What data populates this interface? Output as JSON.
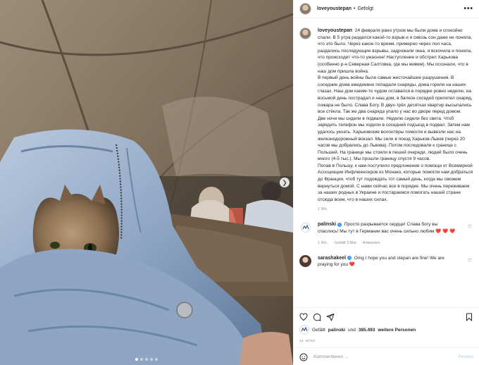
{
  "post": {
    "username": "loveyoustepan",
    "separator": "•",
    "follow_status": "Gefolgt",
    "more_label": "•••",
    "caption": "24 февраля рано утром мы были дома и спокойно спали. В 5 утра раздался какой-то взрыв и я сквозь сон даже не поняла, что это было. Через какое-то время, примерно через пол часа, раздались последующие взрывы, задрожали окна, я вскочила и поняла, что происходит что-то ужасное! Наступление и обстрел Харькова (особенно р-н Северная Салтовка, где мы живем). Мы осознали, что в наш дом пришла война.\nВ первый день войны были самые жесточайшие разрушения. В соседние дома ежедневно попадали снаряды, дома горели на наших глазах. Наш дом каким-то чудом оставался в порядке ровно неделю, на восьмой день пострадал и наш дом, в балкон соседей прилетел снаряд, пожара не было, Слава Богу. В двух-трёх десятках квартир высыпались все стёкла. Так же два снаряда упало у нас во дворе перед домом.\nДве ночи мы сидели в подвале. Неделю сидели без света. Чтоб зарядить телефон мы ходили в соседний подъезд в подвал. Затем нам удалось уехать. Харьковские волонтёры помогли и вывезли нас на железнодорожный вокзал. Мы сели в поезд Харьков-Львов (через 20 часов мы добрались до Львова). Потом последовали к границе с Польшей. На границе мы стояли в пешей очереди, людей было очень много (4-5 тыс.). Мы прошли границу спустя 9 часов.\nПопав в Польшу, к нам поступило предложение о помощи от Всемирной Ассоциации Инфлюенсеров из Монако, которые помогли нам добраться до Франции, чтоб тут подождать тот самый день, когда мы сможем вернуться домой. С нами сейчас все в порядке. Мы очень переживаем за наших родных в Украине и постараемся помогать нашей стране отсюда всем, что в наших силах.",
    "caption_age": "1 Wo."
  },
  "comments": [
    {
      "username": "palinski",
      "verified_mark": "✓",
      "text": "Просто разрывается сердце! Слава богу вы спаслись! Мы тут в Германии вас очень сильно любим",
      "hearts": "❤️ ❤️ ❤️",
      "age": "1 Wo.",
      "likes": "Gefällt 3 Mal",
      "reply": "Antworten"
    },
    {
      "username": "sarashakeel",
      "verified_mark": "✓",
      "text": "Omg I hope you and stepan are fine! We are praying for you",
      "hearts": "❤️"
    }
  ],
  "actions": {
    "liked_by_prefix": "Gefällt",
    "liked_by_user": "palinski",
    "liked_by_suffix": "und",
    "likes_count": "385.493",
    "likes_suffix": "weitere Personen",
    "date": "16. MÄRZ"
  },
  "composer": {
    "placeholder": "Kommentieren ...",
    "post_label": "Posten"
  },
  "colors": {
    "verified": "#3897f0",
    "heart": "#ed4956",
    "post_disabled": "#b2dffc",
    "secondary_text": "#8e8e8e"
  },
  "icons": [
    "emoji-icon",
    "heart-icon",
    "comment-icon",
    "share-icon",
    "bookmark-icon",
    "chevron-right-icon",
    "more-icon",
    "verified-icon"
  ]
}
